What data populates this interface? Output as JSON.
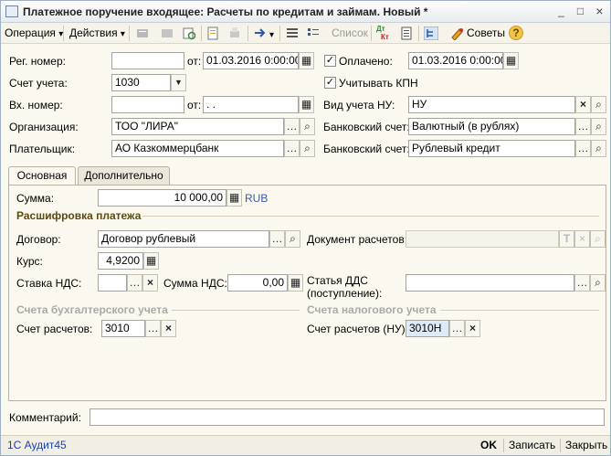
{
  "window": {
    "title": "Платежное поручение входящее: Расчеты по кредитам и займам. Новый *",
    "controls": [
      "_",
      "□",
      "×"
    ]
  },
  "toolbar": {
    "operation": "Операция",
    "actions": "Действия",
    "list": "Список",
    "dtkt_top": "Дт",
    "dtkt_bottom": "Кт",
    "tips": "Советы",
    "help": "?"
  },
  "form": {
    "reg_label": "Рег. номер:",
    "reg_value": "",
    "from1": "от:",
    "reg_date": "01.03.2016  0:00:00",
    "paid_label": "Оплачено:",
    "paid_checked": "✓",
    "paid_date": "01.03.2016  0:00:00",
    "account_label": "Счет учета:",
    "account_value": "1030",
    "kpn_label": "Учитывать КПН",
    "kpn_checked": "✓",
    "in_label": "Вх. номер:",
    "in_value": "",
    "from2": "от:",
    "in_date": " .  .",
    "tax_type_label": "Вид учета НУ:",
    "tax_type_value": "НУ",
    "org_label": "Организация:",
    "org_value": "ТОО \"ЛИРА\"",
    "bank1_label": "Банковский счет:",
    "bank1_value": "Валютный (в рублях)",
    "payer_label": "Плательщик:",
    "payer_value": "АО Казкоммерцбанк",
    "bank2_label": "Банковский счет:",
    "bank2_value": "Рублевый кредит"
  },
  "tabs": [
    {
      "label": "Основная"
    },
    {
      "label": "Дополнительно"
    }
  ],
  "main": {
    "sum_label": "Сумма:",
    "sum_value": "10 000,00",
    "currency": "RUB",
    "section_title": "Расшифровка платежа",
    "contract_label": "Договор:",
    "contract_value": "Договор рублевый",
    "doc_label": "Документ расчетов:",
    "doc_value": "",
    "rate_label": "Курс:",
    "rate_value": "4,9200",
    "vat_rate_label": "Ставка НДС:",
    "vat_rate_value": "",
    "vat_sum_label": "Сумма НДС:",
    "vat_sum_value": "0,00",
    "dds_label_1": "Статья ДДС",
    "dds_label_2": "(поступление):",
    "dds_value": "",
    "acc_section": "Счета бухгалтерского учета",
    "tax_section": "Счета налогового учета",
    "acc_calc_label": "Счет расчетов:",
    "acc_calc_value": "3010",
    "tax_calc_label": "Счет расчетов (НУ):",
    "tax_calc_value": "3010Н"
  },
  "comment_label": "Комментарий:",
  "comment_value": "",
  "bottom": {
    "company": "1С Аудит45",
    "ok": "OK",
    "save": "Записать",
    "close": "Закрыть"
  }
}
